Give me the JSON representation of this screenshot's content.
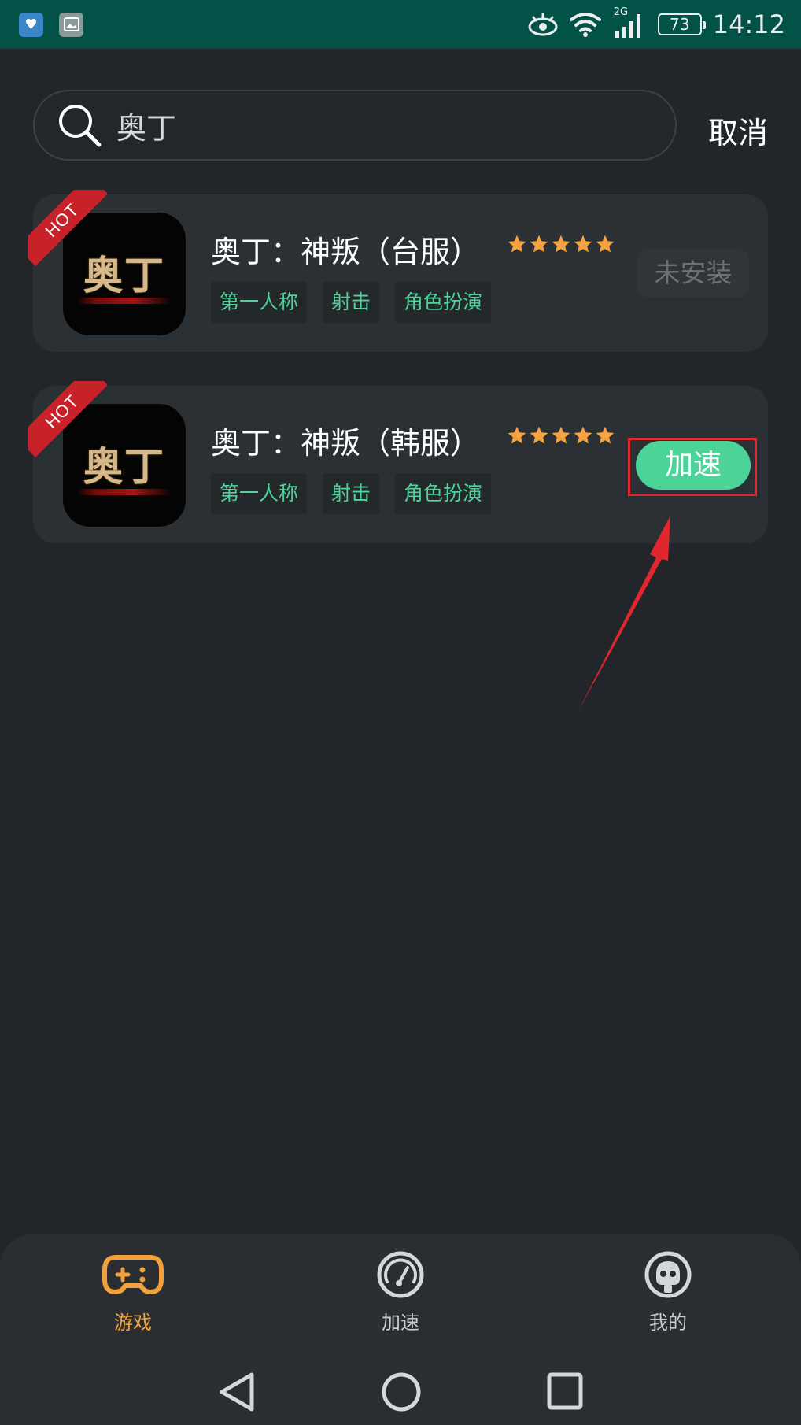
{
  "status_bar": {
    "network": "2G",
    "battery": "73",
    "time": "14:12"
  },
  "search": {
    "value": "奥丁",
    "cancel_label": "取消"
  },
  "games": [
    {
      "title": "奥丁：神叛（台服）",
      "badge": "HOT",
      "logo_text": "奥丁",
      "rating_stars": 5,
      "tags": [
        "第一人称",
        "射击",
        "角色扮演"
      ],
      "action_label": "未安装"
    },
    {
      "title": "奥丁：神叛（韩服）",
      "badge": "HOT",
      "logo_text": "奥丁",
      "rating_stars": 5,
      "tags": [
        "第一人称",
        "射击",
        "角色扮演"
      ],
      "action_label": "加速"
    }
  ],
  "bottom_nav": {
    "items": [
      {
        "label": "游戏",
        "icon": "gamepad-icon",
        "active": true
      },
      {
        "label": "加速",
        "icon": "speedometer-icon",
        "active": false
      },
      {
        "label": "我的",
        "icon": "profile-icon",
        "active": false
      }
    ]
  },
  "colors": {
    "background": "#22262a",
    "status_bar": "#035247",
    "card": "#2b3034",
    "accent_green": "#4cd498",
    "tag_text": "#4fd39a",
    "active_nav": "#f3a13b",
    "hot_badge": "#c8212a",
    "annotation_red": "#e2262e",
    "star": "#f4a340"
  }
}
